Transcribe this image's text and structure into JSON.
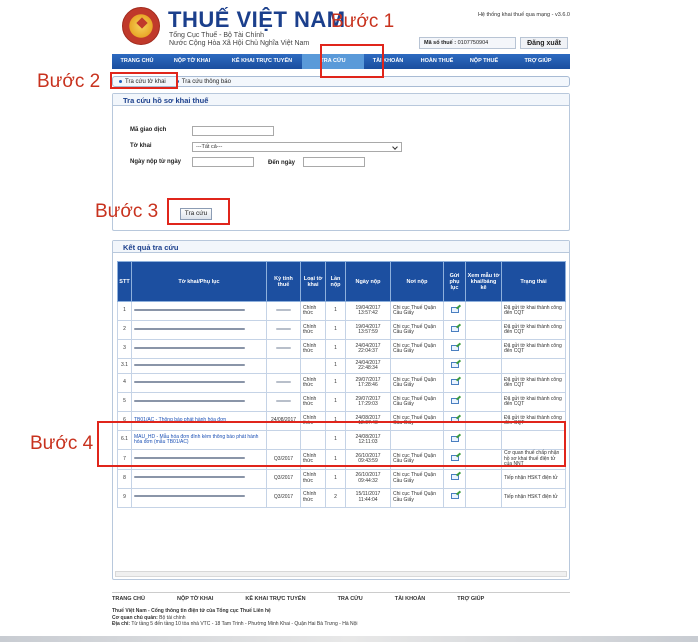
{
  "header": {
    "brand": "THUẾ VIỆT NAM",
    "sub1": "Tổng Cục Thuế - Bộ Tài Chính",
    "sub2": "Nước Cộng Hòa Xã Hội Chủ Nghĩa Việt Nam",
    "system": "Hệ thống khai thuế qua mạng - v3.6.0",
    "mst_label": "Mã số thuế :",
    "mst_value": "0107750904",
    "logout": "Đăng xuất"
  },
  "annotations": {
    "b1": "Bước 1",
    "b2": "Bước 2",
    "b3": "Bước 3",
    "b4": "Bước 4"
  },
  "nav": [
    {
      "label": "TRANG CHỦ",
      "active": false
    },
    {
      "label": "NỘP TỜ KHAI",
      "active": false
    },
    {
      "label": "KÊ KHAI TRỰC TUYẾN",
      "active": false
    },
    {
      "label": "TRA CỨU",
      "active": true
    },
    {
      "label": "TÀI KHOẢN",
      "active": false
    },
    {
      "label": "HOÀN THUẾ",
      "active": false
    },
    {
      "label": "NỘP THUẾ",
      "active": false
    },
    {
      "label": "TRỢ GIÚP",
      "active": false
    }
  ],
  "subtabs": {
    "a": "Tra cứu tờ khai",
    "b": "Tra cứu thông báo"
  },
  "search": {
    "title": "Tra cứu hồ sơ khai thuế",
    "ma_gd": "Mã giao dịch",
    "to_khai": "Tờ khai",
    "to_khai_value": "---Tất cả---",
    "tu_ngay": "Ngày nộp từ ngày",
    "den_ngay": "Đến ngày",
    "button": "Tra cứu"
  },
  "results": {
    "title": "Kết quả tra cứu",
    "headers": [
      "STT",
      "Tờ khai/Phụ lục",
      "Kỳ tính thuế",
      "Loại tờ khai",
      "Lần nộp",
      "Ngày nộp",
      "Nơi nộp",
      "Gửi phụ lục",
      "Xem mẫu tờ khai/bảng kê",
      "Trạng thái"
    ],
    "rows": [
      {
        "stt": "1",
        "name": "",
        "ky": "",
        "loai": "Chính thức",
        "lan": "1",
        "ngay": "19/04/2017 13:57:42",
        "noi": "Chi cục Thuế Quận Cầu Giấy",
        "gui": true,
        "tt": "Đã gửi tờ khai thành công đến CQT"
      },
      {
        "stt": "2",
        "name": "",
        "ky": "",
        "loai": "Chính thức",
        "lan": "1",
        "ngay": "19/04/2017 13:57:59",
        "noi": "Chi cục Thuế Quận Cầu Giấy",
        "gui": true,
        "tt": "Đã gửi tờ khai thành công đến CQT"
      },
      {
        "stt": "3",
        "name": "",
        "ky": "",
        "loai": "Chính thức",
        "lan": "1",
        "ngay": "24/04/2017 22:04:37",
        "noi": "Chi cục Thuế Quận Cầu Giấy",
        "gui": true,
        "tt": "Đã gửi tờ khai thành công đến CQT"
      },
      {
        "stt": "3.1",
        "name": "",
        "ky": "",
        "loai": "",
        "lan": "1",
        "ngay": "24/04/2017 22:48:34",
        "noi": "",
        "gui": true,
        "tt": ""
      },
      {
        "stt": "4",
        "name": "",
        "ky": "",
        "loai": "Chính thức",
        "lan": "1",
        "ngay": "29/07/2017 17:28:46",
        "noi": "Chi cục Thuế Quận Cầu Giấy",
        "gui": true,
        "tt": "Đã gửi tờ khai thành công đến CQT"
      },
      {
        "stt": "5",
        "name": "",
        "ky": "",
        "loai": "Chính thức",
        "lan": "1",
        "ngay": "29/07/2017 17:29:03",
        "noi": "Chi cục Thuế Quận Cầu Giấy",
        "gui": true,
        "tt": "Đã gửi tờ khai thành công đến CQT"
      },
      {
        "stt": "6",
        "name": "TB01/AC - Thông báo phát hành hóa đơn",
        "ky": "24/08/2017",
        "loai": "Chính thức",
        "lan": "1",
        "ngay": "24/08/2017 12:07:48",
        "noi": "Chi cục Thuế Quận Cầu Giấy",
        "gui": true,
        "tt": "Đã gửi tờ khai thành công đến CQT"
      },
      {
        "stt": "6.1",
        "name": "MAU_HD - Mẫu hóa đơn đính kèm thông báo phát hành hóa đơn (mẫu TB01/AC)",
        "ky": "",
        "loai": "",
        "lan": "1",
        "ngay": "24/08/2017 12:11:03",
        "noi": "",
        "gui": true,
        "tt": ""
      },
      {
        "stt": "7",
        "name": "",
        "ky": "Q3/2017",
        "loai": "Chính thức",
        "lan": "1",
        "ngay": "26/10/2017 09:43:59",
        "noi": "Chi cục Thuế Quận Cầu Giấy",
        "gui": true,
        "tt": "Cơ quan thuế chấp nhận hồ sơ khai thuế điện tử của NNT"
      },
      {
        "stt": "8",
        "name": "",
        "ky": "Q3/2017",
        "loai": "Chính thức",
        "lan": "1",
        "ngay": "26/10/2017 09:44:32",
        "noi": "Chi cục Thuế Quận Cầu Giấy",
        "gui": true,
        "tt": "Tiếp nhận HSKT điện tử"
      },
      {
        "stt": "9",
        "name": "",
        "ky": "Q3/2017",
        "loai": "Chính thức",
        "lan": "2",
        "ngay": "15/11/2017 11:44:04",
        "noi": "Chi cục Thuế Quận Cầu Giấy",
        "gui": true,
        "tt": "Tiếp nhận HSKT điện tử"
      }
    ]
  },
  "footer": {
    "nav": [
      "TRANG CHỦ",
      "NỘP TỜ KHAI",
      "KÊ KHAI TRỰC TUYẾN",
      "TRA CỨU",
      "TÀI KHOẢN",
      "TRỢ GIÚP"
    ],
    "line1": "Thuế Việt Nam - Cổng thông tin điện tử của Tổng cục Thuế Liên hệ",
    "line2_label": "Cơ quan chủ quản:",
    "line2": "Bộ tài chính",
    "line3_label": "Địa chỉ:",
    "line3": "Từ tầng 5 đến tầng 10 tòa nhà VTC - 18 Tam Trinh - Phường Minh Khai - Quận Hai Bà Trưng - Hà Nội"
  }
}
